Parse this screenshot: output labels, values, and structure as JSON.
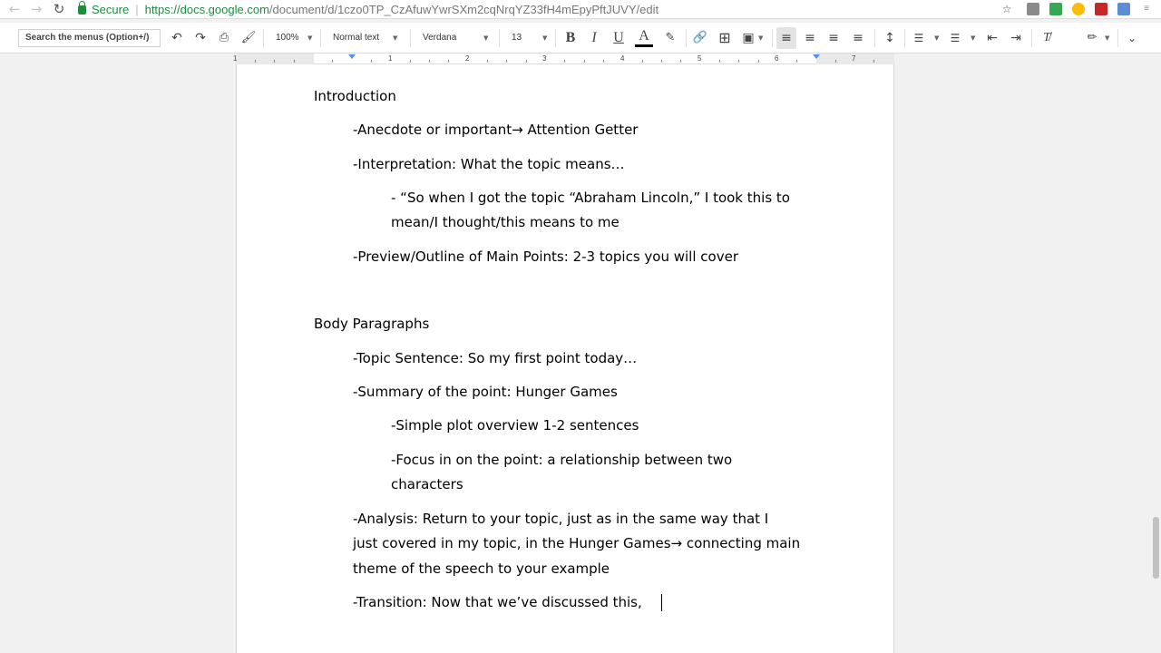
{
  "browser": {
    "secure_label": "Secure",
    "url_host": "https://docs.google.com",
    "url_path": "/document/d/1czo0TP_CzAfuwYwrSXm2cqNrqYZ33fH4mEpyPftJUVY/edit"
  },
  "toolbar": {
    "menu_search_placeholder": "Search the menus (Option+/)",
    "zoom": "100%",
    "style": "Normal text",
    "font": "Verdana",
    "font_size": "13"
  },
  "ruler": {
    "numbers": [
      "1",
      "1",
      "2",
      "3",
      "4",
      "5",
      "6",
      "7"
    ]
  },
  "document": {
    "introduction_heading": "Introduction",
    "intro_anecdote": "-Anecdote or important→ Attention Getter",
    "intro_interpretation": "-Interpretation: What the topic means…",
    "intro_quote_line1": "- “So when I got the topic “Abraham Lincoln,” I took this to",
    "intro_quote_line2": "mean/I thought/this means to me",
    "intro_preview": "-Preview/Outline of Main Points: 2-3 topics you will cover",
    "body_heading": "Body Paragraphs",
    "body_topic_sentence": "-Topic Sentence: So my first point today…",
    "body_summary": "-Summary of the point: Hunger Games",
    "body_plot_overview": "-Simple plot overview 1-2 sentences",
    "body_focus_line1": "-Focus in on the point: a relationship between two",
    "body_focus_line2": "characters",
    "body_analysis_line1": "-Analysis: Return to your topic, just as in the same way that I",
    "body_analysis_line2": "just covered in my topic, in the Hunger Games→ connecting main",
    "body_analysis_line3": "theme of the speech to your example",
    "body_transition": "-Transition: Now that we’ve discussed this,"
  },
  "colors": {
    "secure_green": "#1e8e3e",
    "indent_marker": "#4d90fe",
    "page_background": "#f1f1f1"
  }
}
